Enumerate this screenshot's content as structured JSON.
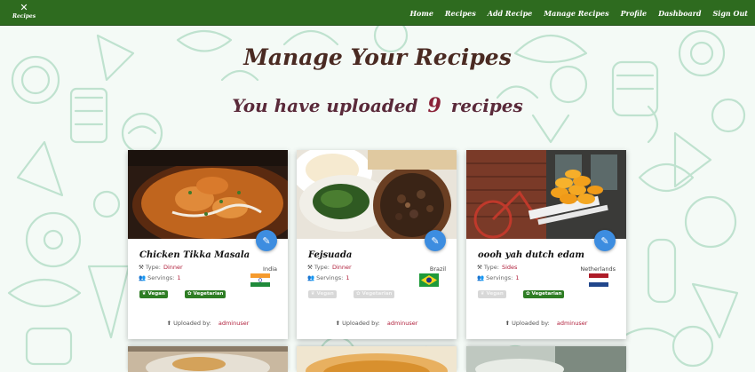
{
  "brand": {
    "icon": "fork-knife-icon",
    "text": "Recipes"
  },
  "nav": {
    "links": [
      "Home",
      "Recipes",
      "Add Recipe",
      "Manage Recipes",
      "Profile",
      "Dashboard",
      "Sign Out"
    ]
  },
  "page": {
    "title": "Manage Your Recipes",
    "subtitle_prefix": "You have uploaded",
    "count": "9",
    "subtitle_suffix": "recipes"
  },
  "labels": {
    "type": "Type:",
    "servings": "Servings:",
    "uploaded_by": "Uploaded by:",
    "vegan": "Vegan",
    "vegetarian": "Vegetarian"
  },
  "recipes": [
    {
      "name": "Chicken Tikka Masala",
      "type": "Dinner",
      "servings": "1",
      "country": "India",
      "flag": "india-flag-icon",
      "vegan": false,
      "vegetarian": false,
      "uploader": "adminuser"
    },
    {
      "name": "Fejsuada",
      "type": "Dinner",
      "servings": "1",
      "country": "Brazil",
      "flag": "brazil-flag-icon",
      "vegan": false,
      "vegetarian": false,
      "uploader": "adminuser"
    },
    {
      "name": "oooh yah dutch edam",
      "type": "Sides",
      "servings": "1",
      "country": "Netherlands",
      "flag": "netherlands-flag-icon",
      "vegan": false,
      "vegetarian": true,
      "uploader": "adminuser"
    }
  ],
  "colors": {
    "navbar": "#2e6b1f",
    "heading": "#4a2a22",
    "accent": "#8a2238",
    "fab": "#3d8de0",
    "badge_active": "#2e7d24"
  }
}
